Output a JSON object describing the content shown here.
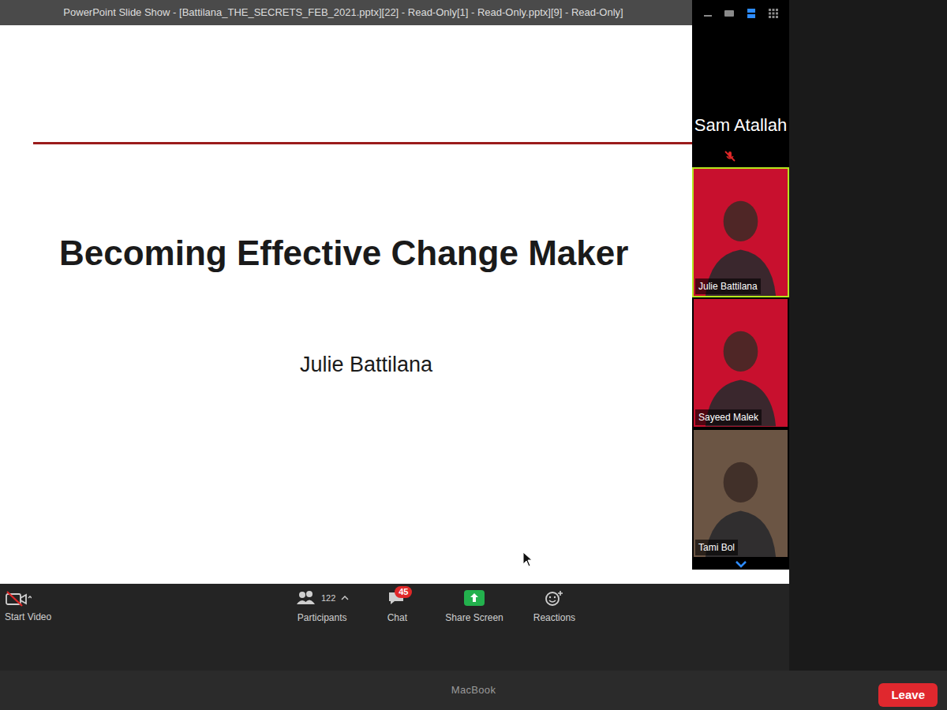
{
  "window": {
    "title": "PowerPoint Slide Show - [Battilana_THE_SECRETS_FEB_2021.pptx][22] - Read-Only[1] - Read-Only.pptx][9] - Read-Only]"
  },
  "slide": {
    "title": "Becoming Effective Change Maker",
    "author": "Julie Battilana"
  },
  "participants": [
    {
      "name": "Sam Atallah",
      "muted": true,
      "video": false,
      "speaking": false
    },
    {
      "name": "Julie Battilana",
      "muted": false,
      "video": true,
      "speaking": true
    },
    {
      "name": "Sayeed Malek",
      "muted": false,
      "video": true,
      "speaking": false
    },
    {
      "name": "Tami Bol",
      "muted": false,
      "video": true,
      "speaking": false
    }
  ],
  "toolbar": {
    "video": {
      "label": "Start Video",
      "on": false
    },
    "items": [
      {
        "kind": "participants",
        "label": "Participants",
        "count": "122"
      },
      {
        "kind": "chat",
        "label": "Chat",
        "badge": "45"
      },
      {
        "kind": "share",
        "label": "Share Screen"
      },
      {
        "kind": "reactions",
        "label": "Reactions"
      }
    ]
  },
  "leave": {
    "label": "Leave"
  },
  "bezel": {
    "label": "MacBook"
  }
}
